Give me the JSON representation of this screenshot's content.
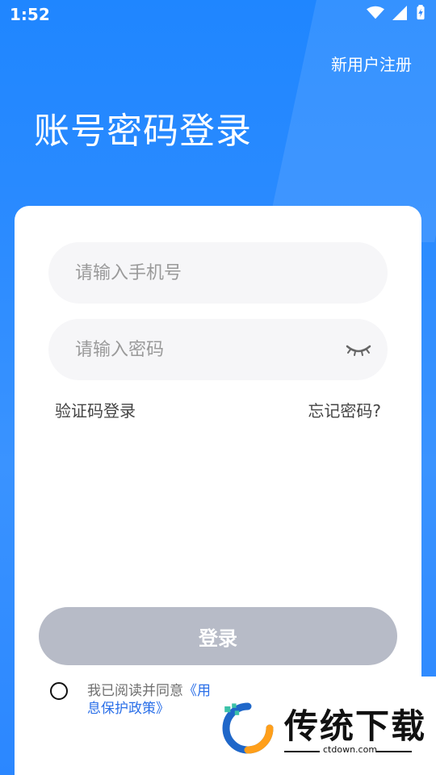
{
  "status_bar": {
    "time": "1:52",
    "icons": [
      "wifi-icon",
      "signal-icon",
      "battery-charging-icon"
    ]
  },
  "header": {
    "register_link": "新用户注册",
    "title": "账号密码登录"
  },
  "form": {
    "phone_placeholder": "请输入手机号",
    "password_placeholder": "请输入密码",
    "eye_icon": "eye-closed-icon",
    "sms_login_label": "验证码登录",
    "forgot_password_label": "忘记密码?",
    "login_button": "登录"
  },
  "agreement": {
    "line1_prefix": "我已阅读并同意",
    "line1_link_visible": "《用",
    "line2_link_visible": "息保护政策》"
  },
  "watermark": {
    "brand": "传统下载",
    "url": "ctdown.com"
  },
  "colors": {
    "primary_blue": "#2b87ff",
    "button_gray": "#b7bbc7",
    "field_bg": "#f6f6f8",
    "link_blue": "#2a6fe8"
  }
}
